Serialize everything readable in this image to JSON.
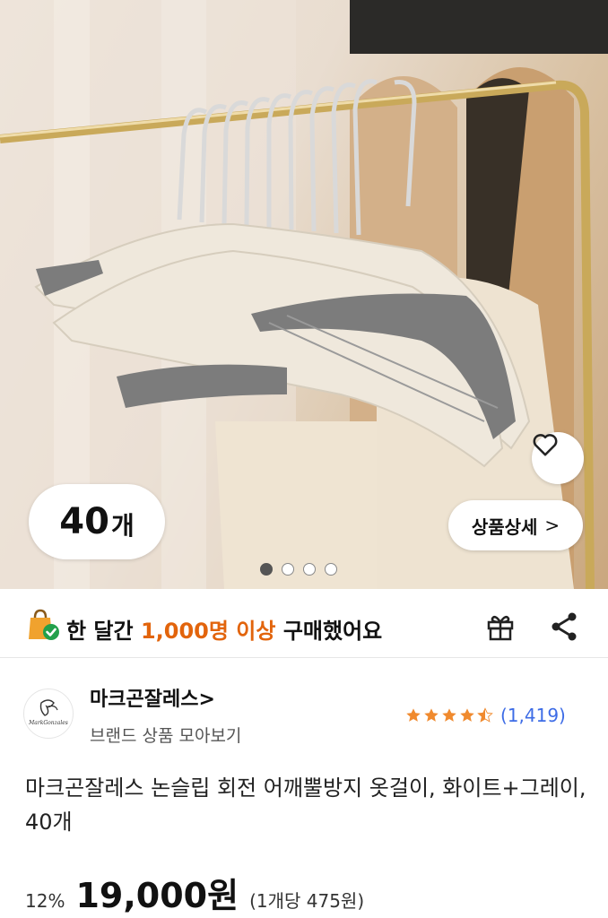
{
  "gallery": {
    "quantity_number": "40",
    "quantity_unit": "개",
    "detail_button_label": "상품상세",
    "detail_chevron": ">",
    "page_count": 4,
    "active_page": 1
  },
  "purchase_info": {
    "prefix": "한 달간 ",
    "highlight": "1,000명 이상",
    "suffix": " 구매했어요"
  },
  "seller": {
    "name": "마크곤잘레스>",
    "sub_label": "브랜드 상품 모아보기",
    "logo_text": "MarkGonzales",
    "rating": 4.5,
    "review_count": "(1,419)"
  },
  "product": {
    "title": "마크곤잘레스 논슬립 회전 어깨뿔방지 옷걸이, 화이트+그레이, 40개",
    "discount": "12%",
    "price": "19,000원",
    "unit_price": "(1개당 475원)"
  },
  "colors": {
    "highlight": "#e2640c",
    "review_link": "#3d6ce6",
    "star": "#f08a2e"
  },
  "icons": {
    "wishlist": "heart-outline-icon",
    "purchase": "shopping-bag-check-icon",
    "gift": "gift-icon",
    "share": "share-icon",
    "rating": "star-icon"
  }
}
